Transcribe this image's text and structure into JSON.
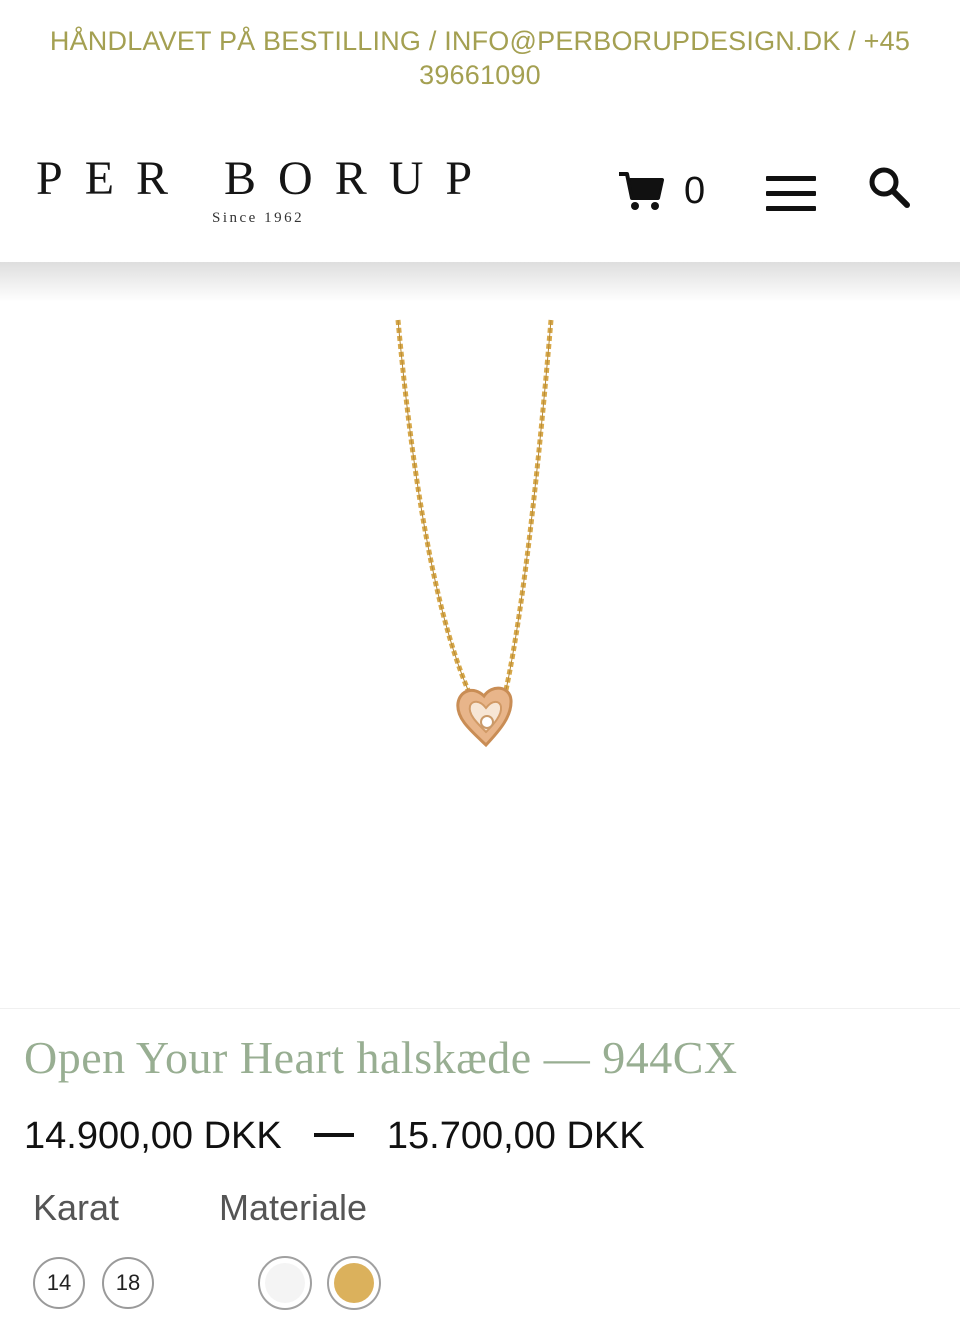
{
  "topbar": {
    "line1": "HÅNDLAVET PÅ BESTILLING / INFO@PERBORUPDESIGN.DK / +45",
    "line2": "39661090",
    "color": "#a4a052"
  },
  "header": {
    "logo_name": "PER BORUP",
    "logo_sub": "Since 1962",
    "cart_count": "0",
    "icons": [
      "cart-icon",
      "hamburger-menu-icon",
      "search-icon"
    ]
  },
  "product": {
    "image_alt": "necklace-product-image",
    "title": "Open Your Heart halskæde — 944CX",
    "title_color": "#98ae92",
    "price_min": "14.900,00 DKK",
    "price_max": "15.700,00 DKK",
    "karat_label": "Karat",
    "material_label": "Materiale",
    "karat_options": [
      "14",
      "18"
    ],
    "material_options": [
      {
        "name": "white-gold",
        "color": "#f4f4f4"
      },
      {
        "name": "yellow-gold",
        "color": "#dbb15c"
      }
    ]
  }
}
